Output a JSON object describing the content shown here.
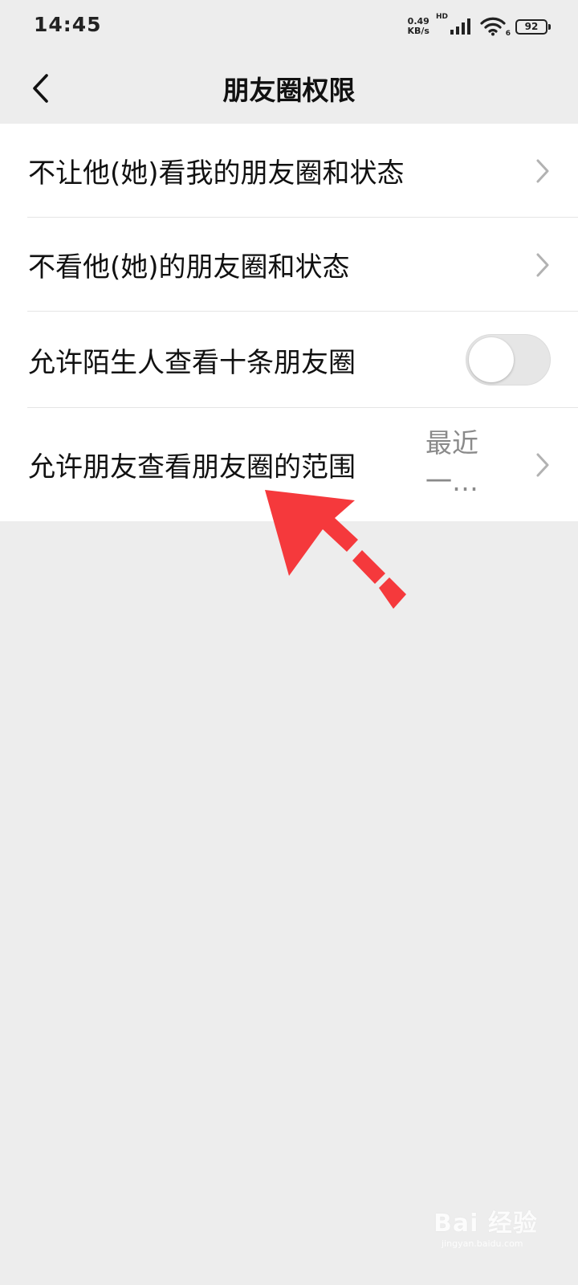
{
  "status_bar": {
    "time": "14:45",
    "net_speed_value": "0.49",
    "net_speed_unit": "KB/s",
    "hd_label": "HD",
    "wifi_sub": "6",
    "battery_level": "92"
  },
  "nav": {
    "title": "朋友圈权限",
    "back_icon": "chevron-left-icon"
  },
  "settings": {
    "items": [
      {
        "label": "不让他(她)看我的朋友圈和状态",
        "control": "chevron"
      },
      {
        "label": "不看他(她)的朋友圈和状态",
        "control": "chevron"
      },
      {
        "label": "允许陌生人查看十条朋友圈",
        "control": "toggle",
        "toggle_on": false
      },
      {
        "label": "允许朋友查看朋友圈的范围",
        "control": "chevron",
        "value": "最近一…"
      }
    ]
  },
  "annotation": {
    "arrow_color": "#f5393c"
  },
  "watermark": {
    "text": "Bai 经验",
    "url": "jingyan.baidu.com"
  },
  "colors": {
    "background": "#ededed",
    "list_background": "#ffffff",
    "divider": "#e5e5e5",
    "value_text": "#8a8a8a",
    "chevron": "#b2b2b2"
  }
}
